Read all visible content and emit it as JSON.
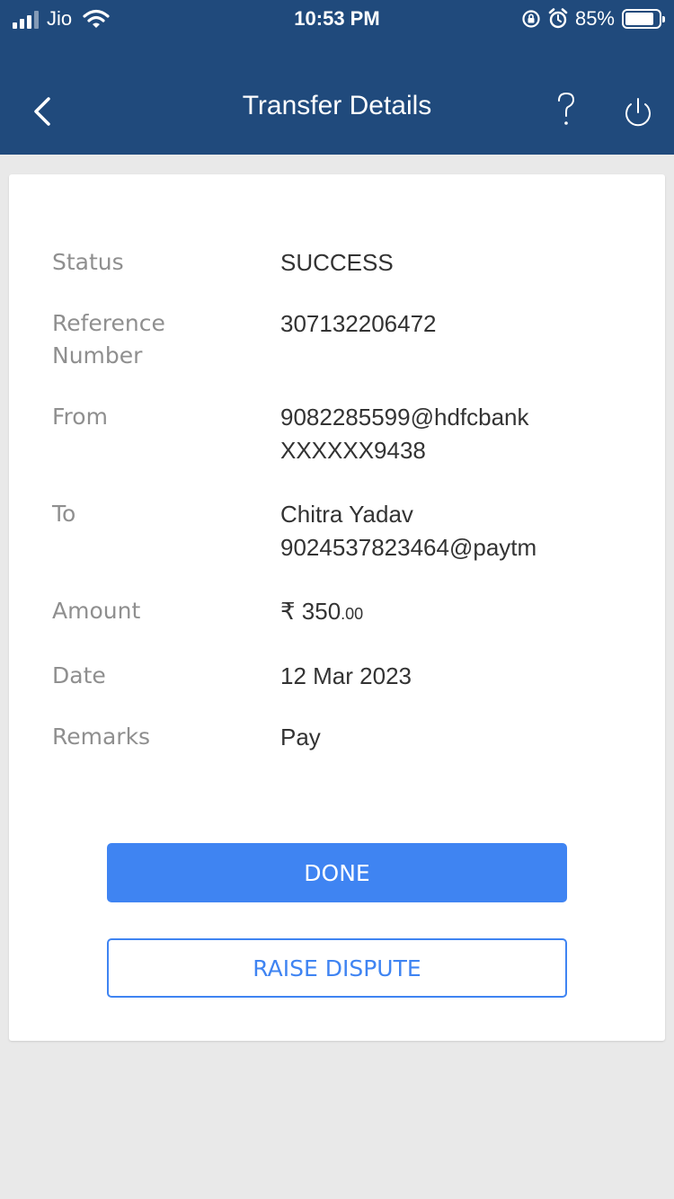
{
  "status_bar": {
    "carrier": "Jio",
    "time": "10:53 PM",
    "battery": "85%",
    "battery_fraction": 0.85
  },
  "header": {
    "title": "Transfer Details",
    "back_icon": "chevron-left-icon",
    "help_icon": "question-mark-icon",
    "power_icon": "power-icon"
  },
  "details": [
    {
      "label": "Status",
      "value": "SUCCESS"
    },
    {
      "label": "Reference Number",
      "value": "307132206472"
    },
    {
      "label": "From",
      "value_line1": "9082285599@hdfcbank",
      "value_line2": "XXXXXX9438"
    },
    {
      "label": "To",
      "value_line1": "Chitra Yadav",
      "value_line2": "9024537823464@paytm"
    },
    {
      "label": "Amount",
      "currency": "₹",
      "amount_main": "350",
      "amount_cents": ".00"
    },
    {
      "label": "Date",
      "value": "12 Mar 2023"
    },
    {
      "label": "Remarks",
      "value": "Pay"
    }
  ],
  "actions": {
    "done_label": "DONE",
    "dispute_label": "RAISE DISPUTE"
  },
  "colors": {
    "header_bg": "#204a7c",
    "primary": "#3f84f2",
    "page_bg": "#e9e9e9"
  }
}
